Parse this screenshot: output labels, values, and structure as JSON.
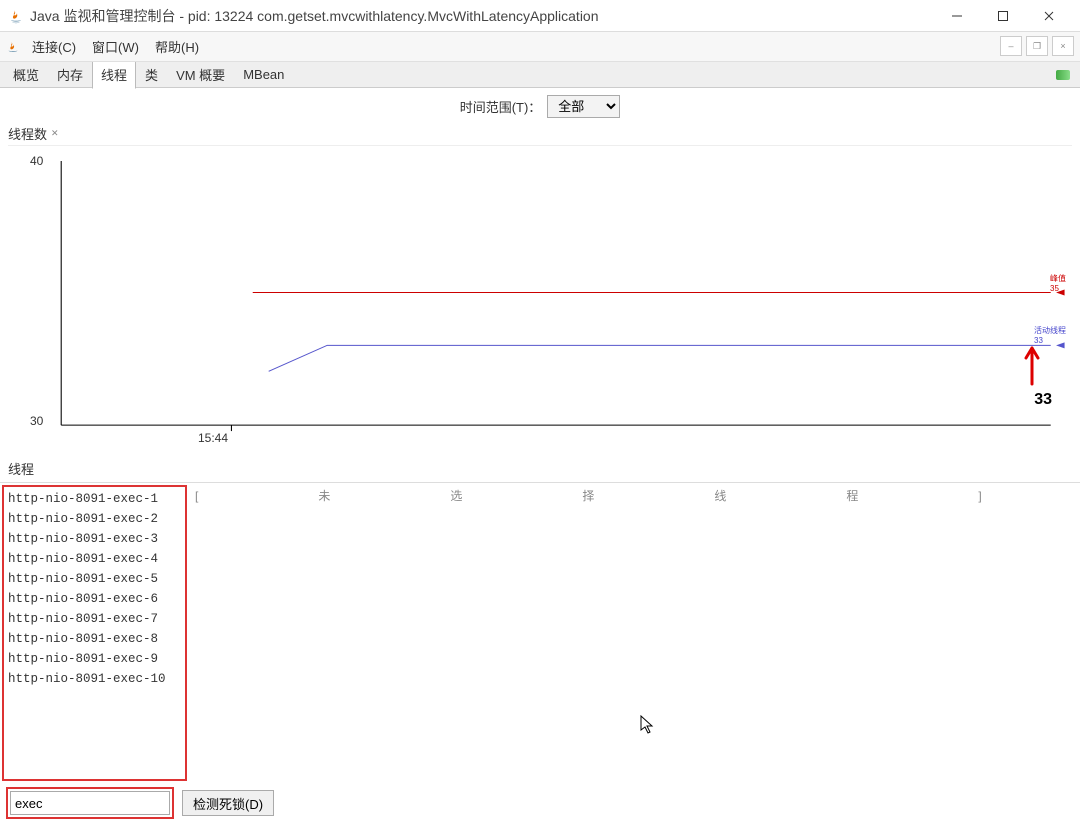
{
  "titlebar": {
    "title": "Java 监视和管理控制台 - pid: 13224 com.getset.mvcwithlatency.MvcWithLatencyApplication"
  },
  "menubar": {
    "connect": "连接(C)",
    "window": "窗口(W)",
    "help": "帮助(H)"
  },
  "tabs": {
    "overview": "概览",
    "memory": "内存",
    "threads": "线程",
    "classes": "类",
    "vm_summary": "VM 概要",
    "mbean": "MBean"
  },
  "chart": {
    "range_label": "时间范围(T)：",
    "range_value": "全部",
    "section_title": "线程数",
    "y_top": "40",
    "y_bottom": "30",
    "x_tick": "15:44",
    "legend_peak_label": "峰值",
    "legend_peak_val": "35",
    "legend_live_label": "活动线程",
    "legend_live_val": "33",
    "annotation_value": "33"
  },
  "threads": {
    "section_title": "线程",
    "detail_placeholder": "[未选择线程]",
    "items": [
      "http-nio-8091-exec-1",
      "http-nio-8091-exec-2",
      "http-nio-8091-exec-3",
      "http-nio-8091-exec-4",
      "http-nio-8091-exec-5",
      "http-nio-8091-exec-6",
      "http-nio-8091-exec-7",
      "http-nio-8091-exec-8",
      "http-nio-8091-exec-9",
      "http-nio-8091-exec-10"
    ]
  },
  "bottom": {
    "filter_value": "exec",
    "deadlock_btn": "检测死锁(D)"
  },
  "chart_data": {
    "type": "line",
    "title": "线程数",
    "xlabel": "",
    "ylabel": "",
    "ylim": [
      30,
      40
    ],
    "x_ticks": [
      "15:44"
    ],
    "series": [
      {
        "name": "峰值",
        "color": "#cc0000",
        "values": [
          35,
          35,
          35,
          35,
          35
        ]
      },
      {
        "name": "活动线程",
        "color": "#5555cc",
        "values": [
          31,
          33,
          33,
          33,
          33
        ]
      }
    ],
    "annotation": {
      "label": "33",
      "target_series": "活动线程"
    }
  }
}
